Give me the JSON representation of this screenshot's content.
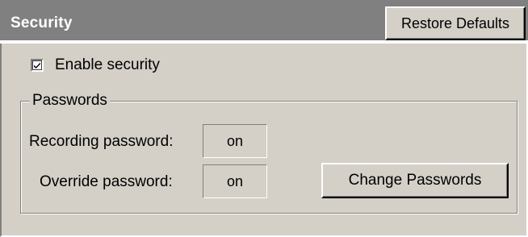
{
  "header": {
    "title": "Security",
    "restore_defaults_label": "Restore Defaults"
  },
  "security": {
    "enable_label": "Enable security",
    "enable_checked": true
  },
  "passwords_group": {
    "legend": "Passwords",
    "recording_label": "Recording password:",
    "recording_value": "on",
    "override_label": "Override password:",
    "override_value": "on",
    "change_button_label": "Change Passwords"
  },
  "colors": {
    "header_bg": "#808080",
    "panel_bg": "#d4d0c8",
    "header_text": "#ffffff"
  },
  "icons": {
    "checkbox": "checkmark-icon"
  }
}
